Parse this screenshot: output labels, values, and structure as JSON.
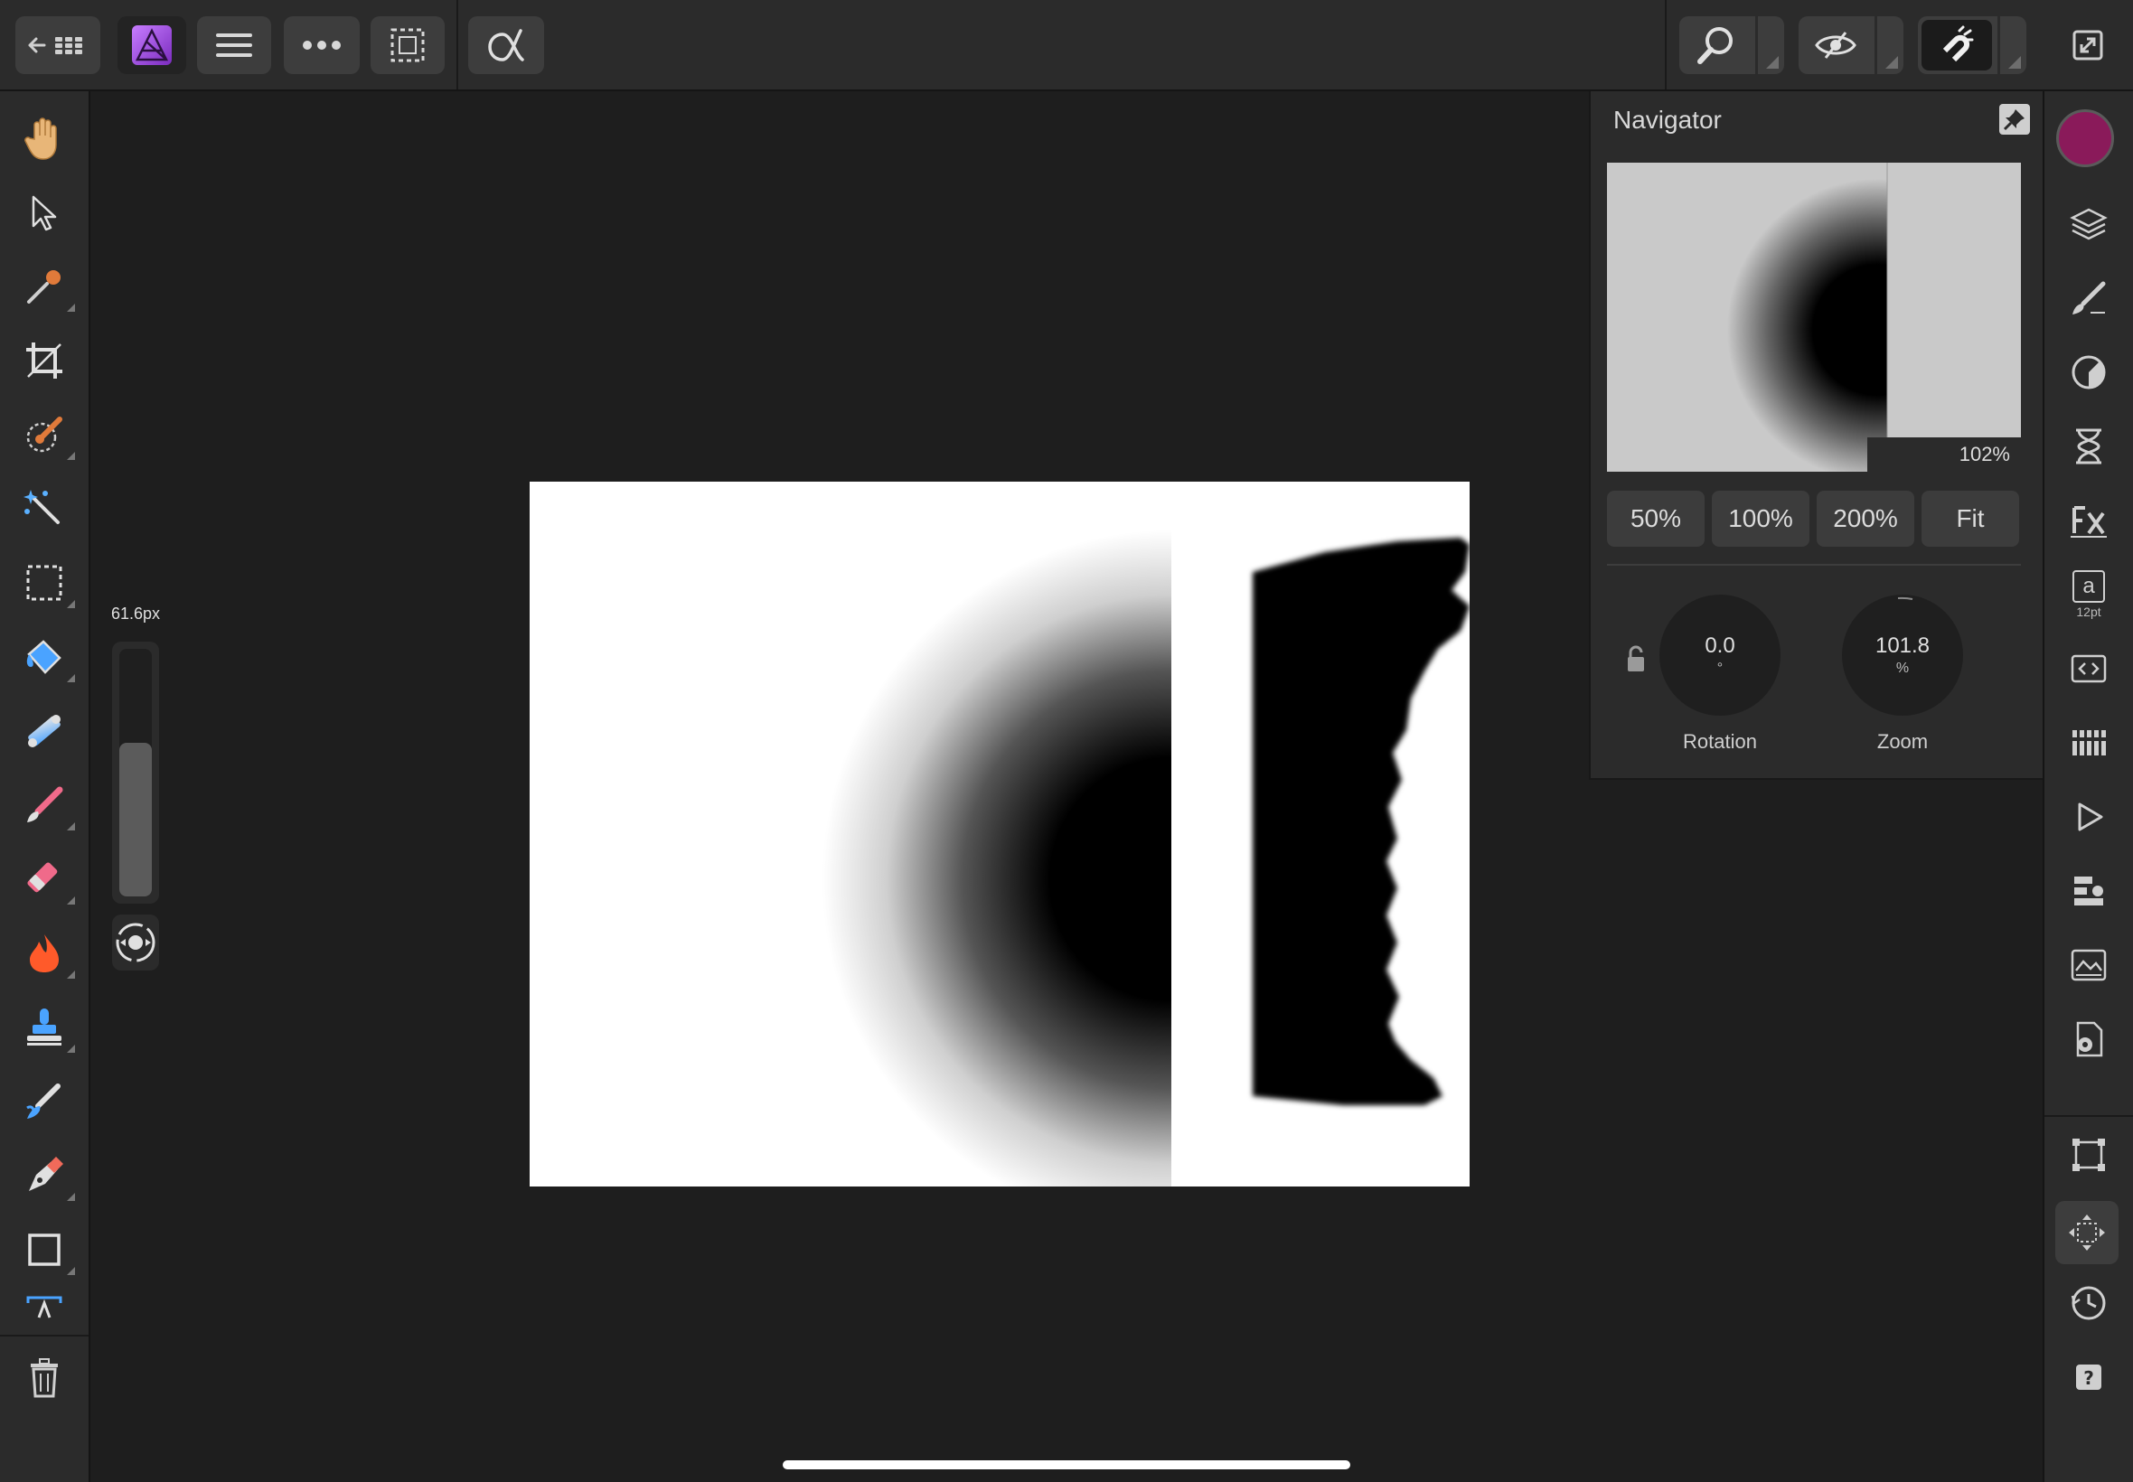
{
  "toolbar": {
    "buttons": [
      "back-to-gallery",
      "affinity-photo-logo",
      "menu",
      "more",
      "selection",
      "alpha"
    ],
    "right_groups": [
      "zoom",
      "view-quality",
      "snapping"
    ],
    "expand_icon": "expand-icon"
  },
  "left_tools": [
    "hand-icon",
    "move-pointer-icon",
    "color-picker-icon",
    "crop-icon",
    "selection-brush-icon",
    "magic-wand-icon",
    "marquee-icon",
    "flood-fill-icon",
    "gradient-icon",
    "paint-brush-icon",
    "eraser-icon",
    "burn-icon",
    "clone-stamp-icon",
    "smudge-icon",
    "pen-icon",
    "rectangle-icon",
    "text-frame-icon"
  ],
  "brush": {
    "size_label": "61.6px",
    "size_fraction": 0.62
  },
  "navigator": {
    "title": "Navigator",
    "preview_zoom": "102%",
    "zoom_buttons": [
      "50%",
      "100%",
      "200%",
      "Fit"
    ],
    "rotation": {
      "value": "0.0",
      "unit": "°",
      "label": "Rotation"
    },
    "zoom": {
      "value": "101.8",
      "unit": "%",
      "label": "Zoom"
    }
  },
  "right_studio": {
    "color": "#8a1a5a",
    "items": [
      "color-swatch",
      "layers-icon",
      "brushes-icon",
      "adjustments-icon",
      "history-icon",
      "fx-icon",
      "text-styles-icon",
      "macro-icon",
      "channels-icon",
      "play-icon",
      "stock-icon",
      "library-icon",
      "document-settings-icon",
      "transform-icon",
      "move-icon",
      "clock-icon",
      "help-icon"
    ],
    "text_style_size": "12pt",
    "text_style_letter": "a"
  }
}
